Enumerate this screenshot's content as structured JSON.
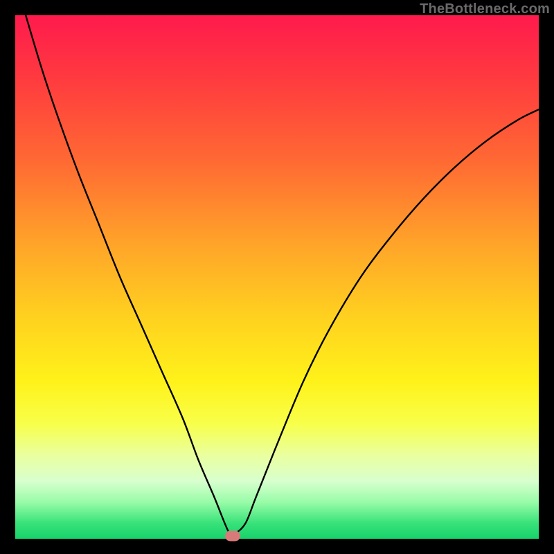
{
  "watermark": "TheBottleneck.com",
  "chart_data": {
    "type": "line",
    "title": "",
    "xlabel": "",
    "ylabel": "",
    "xlim": [
      0,
      100
    ],
    "ylim": [
      0,
      100
    ],
    "grid": false,
    "legend": false,
    "series": [
      {
        "name": "bottleneck-curve",
        "x": [
          2,
          5,
          8,
          12,
          16,
          20,
          24,
          28,
          32,
          35,
          38,
          40,
          41,
          42,
          44,
          46,
          50,
          55,
          60,
          66,
          72,
          78,
          84,
          90,
          96,
          100
        ],
        "values": [
          100,
          90,
          81,
          70,
          60,
          50,
          41,
          32,
          23,
          15,
          8,
          3,
          1,
          1,
          3,
          8,
          18,
          30,
          40,
          50,
          58,
          65,
          71,
          76,
          80,
          82
        ]
      }
    ],
    "marker": {
      "x": 41.5,
      "y": 0.5,
      "color": "#d97a7a"
    },
    "background_gradient": {
      "top": "#ff1a4d",
      "mid": "#fff21a",
      "bottom": "#17d36b"
    }
  }
}
